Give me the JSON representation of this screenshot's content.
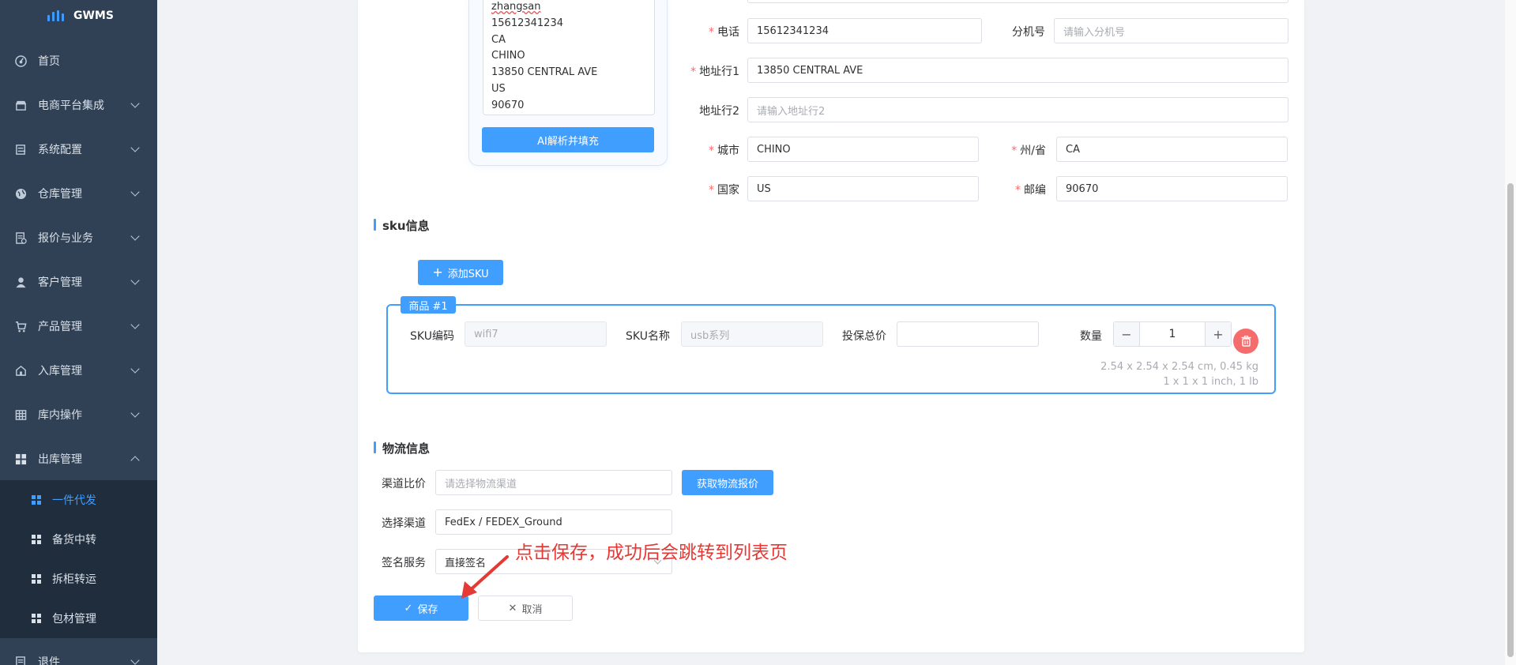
{
  "sidebar": {
    "logo_text": "GWMS",
    "items": [
      {
        "label": "首页"
      },
      {
        "label": "电商平台集成"
      },
      {
        "label": "系统配置"
      },
      {
        "label": "仓库管理"
      },
      {
        "label": "报价与业务"
      },
      {
        "label": "客户管理"
      },
      {
        "label": "产品管理"
      },
      {
        "label": "入库管理"
      },
      {
        "label": "库内操作"
      },
      {
        "label": "出库管理"
      },
      {
        "label": "退件"
      }
    ],
    "subitems": [
      {
        "label": "一件代发",
        "active": true
      },
      {
        "label": "备货中转"
      },
      {
        "label": "拆柜转运"
      },
      {
        "label": "包材管理"
      }
    ]
  },
  "ai_parse": {
    "lines": [
      "zhangsan",
      "15612341234",
      "CA",
      "CHINO",
      "13850 CENTRAL AVE",
      "US",
      "90670"
    ],
    "button_label": "AI解析并填充"
  },
  "address": {
    "phone_label": "电话",
    "phone_value": "15612341234",
    "ext_label": "分机号",
    "ext_placeholder": "请输入分机号",
    "addr1_label": "地址行1",
    "addr1_value": "13850 CENTRAL AVE",
    "addr2_label": "地址行2",
    "addr2_placeholder": "请输入地址行2",
    "city_label": "城市",
    "city_value": "CHINO",
    "state_label": "州/省",
    "state_value": "CA",
    "country_label": "国家",
    "country_value": "US",
    "zip_label": "邮编",
    "zip_value": "90670"
  },
  "sku_section": {
    "title": "sku信息",
    "add_button": "添加SKU",
    "product_tag": "商品 #1",
    "code_label": "SKU编码",
    "code_value": "wifi7",
    "name_label": "SKU名称",
    "name_value": "usb系列",
    "insured_label": "投保总价",
    "insured_value": "",
    "qty_label": "数量",
    "qty_value": "1",
    "dims_metric": "2.54 x 2.54 x 2.54 cm, 0.45 kg",
    "dims_imperial": "1 x 1 x 1 inch, 1 lb"
  },
  "logistics": {
    "title": "物流信息",
    "channel_compare_label": "渠道比价",
    "channel_compare_placeholder": "请选择物流渠道",
    "get_quote_button": "获取物流报价",
    "select_channel_label": "选择渠道",
    "select_channel_value": "FedEx / FEDEX_Ground",
    "signature_label": "签名服务",
    "signature_value": "直接签名"
  },
  "actions": {
    "save": "保存",
    "cancel": "取消"
  },
  "annotation": {
    "text": "点击保存，成功后会跳转到列表页",
    "color": "#e53935"
  },
  "colors": {
    "primary": "#409eff",
    "sidebar_bg": "#304156",
    "submenu_bg": "#1f2d3d",
    "danger": "#f56c6c"
  }
}
